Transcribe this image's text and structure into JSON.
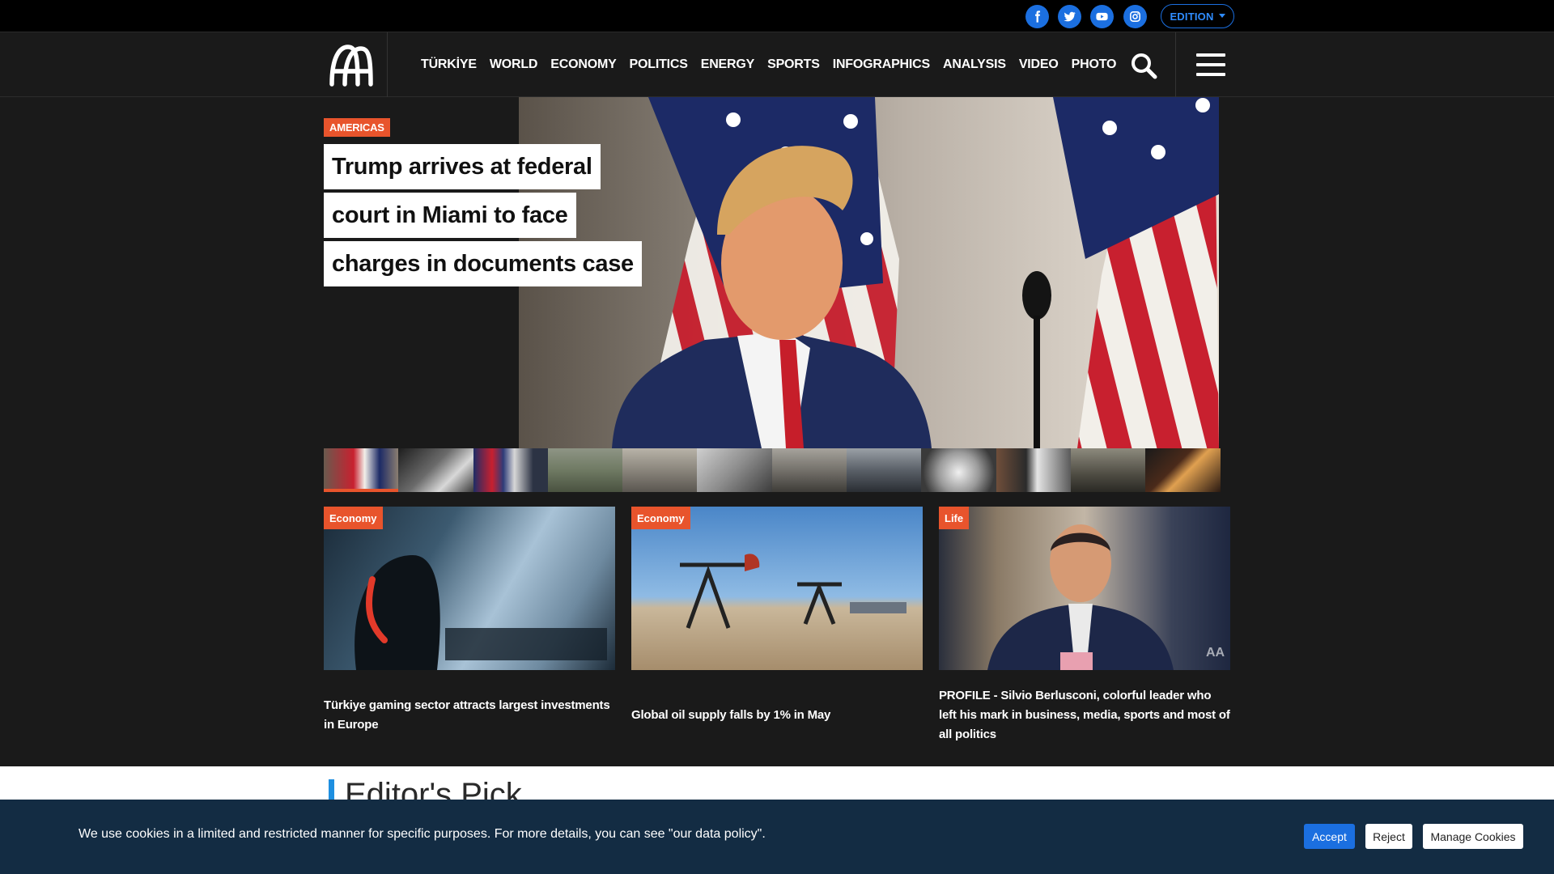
{
  "topbar": {
    "social": [
      {
        "name": "facebook-icon"
      },
      {
        "name": "twitter-icon"
      },
      {
        "name": "youtube-icon"
      },
      {
        "name": "instagram-icon"
      }
    ],
    "edition_label": "EDITION"
  },
  "nav": {
    "items": [
      "TÜRKİYE",
      "WORLD",
      "ECONOMY",
      "POLITICS",
      "ENERGY",
      "SPORTS",
      "INFOGRAPHICS",
      "ANALYSIS",
      "VIDEO",
      "PHOTO"
    ]
  },
  "hero": {
    "tag": "AMERICAS",
    "title_lines": [
      "Trump arrives at federal",
      "court in Miami to face",
      "charges in documents case"
    ]
  },
  "cards": [
    {
      "tag": "Economy",
      "title": "Türkiye gaming sector attracts largest investments in Europe"
    },
    {
      "tag": "Economy",
      "title": "Global oil supply falls by 1% in May"
    },
    {
      "tag": "Life",
      "title": "PROFILE - Silvio Berlusconi, colorful leader who left his mark in business, media, sports and most of all politics"
    }
  ],
  "editors_pick": {
    "title": "Editor's Pick"
  },
  "cookie": {
    "text": "We use cookies in a limited and restricted manner for specific purposes. For more details, you can see \"our data policy\".",
    "accept": "Accept",
    "reject": "Reject",
    "manage": "Manage Cookies"
  },
  "colors": {
    "accent": "#e8542c",
    "brand_blue": "#1b6fe0",
    "cookie_bg": "#132c43"
  }
}
